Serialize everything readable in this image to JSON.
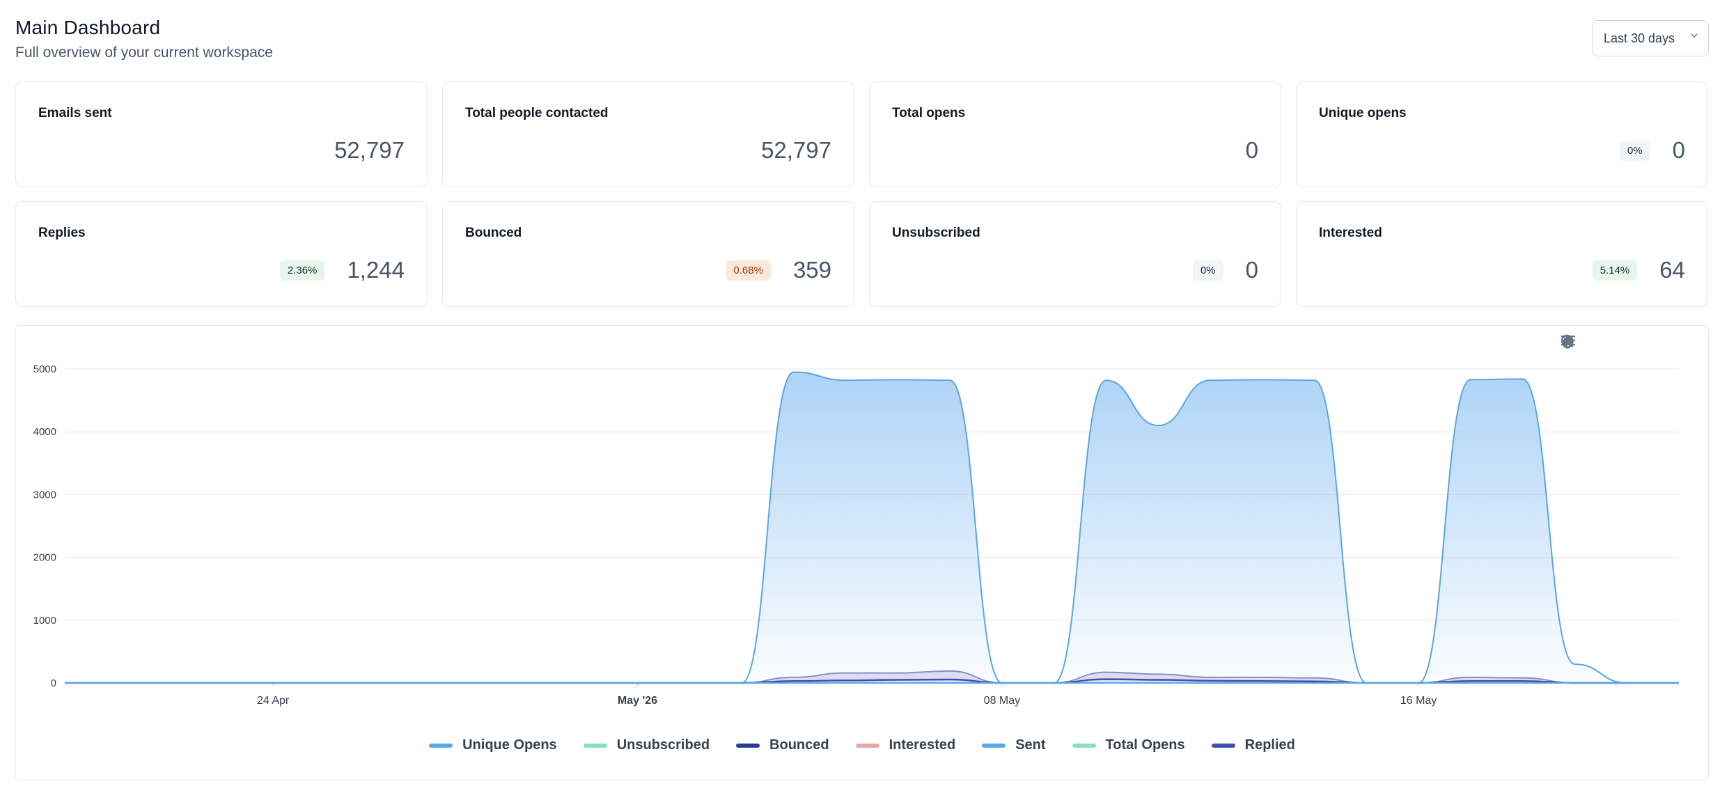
{
  "header": {
    "title": "Main Dashboard",
    "subtitle": "Full overview of your current workspace"
  },
  "range_select": {
    "value": "Last 30 days",
    "icon": "chevron-down-icon"
  },
  "cards": [
    {
      "label": "Emails sent",
      "value": "52,797",
      "badge": null,
      "badge_style": null
    },
    {
      "label": "Total people contacted",
      "value": "52,797",
      "badge": null,
      "badge_style": null
    },
    {
      "label": "Total opens",
      "value": "0",
      "badge": null,
      "badge_style": null
    },
    {
      "label": "Unique opens",
      "value": "0",
      "badge": "0%",
      "badge_style": "neutral"
    },
    {
      "label": "Replies",
      "value": "1,244",
      "badge": "2.36%",
      "badge_style": "green"
    },
    {
      "label": "Bounced",
      "value": "359",
      "badge": "0.68%",
      "badge_style": "orange"
    },
    {
      "label": "Unsubscribed",
      "value": "0",
      "badge": "0%",
      "badge_style": "neutral"
    },
    {
      "label": "Interested",
      "value": "64",
      "badge": "5.14%",
      "badge_style": "green"
    }
  ],
  "toolbar": [
    "zoom-in-icon",
    "zoom-out-icon",
    "zoom-select-icon",
    "pan-hand-icon",
    "home-icon",
    "menu-icon"
  ],
  "colors": {
    "sent": "#5aa6e6",
    "sent_fill": "#a9d1f6",
    "bounced": "#2b3a9a",
    "replied": "#3f4fb0",
    "green_series": "#88e1b9",
    "interested": "#e4a8a8",
    "grid": "#e5e7eb"
  },
  "chart_data": {
    "type": "area",
    "x_start": "2026-04-20",
    "x_end": "2026-05-21",
    "x_tick_labels": [
      {
        "date": "2026-04-24",
        "label": "24 Apr",
        "bold": false
      },
      {
        "date": "2026-05-01",
        "label": "May '26",
        "bold": true
      },
      {
        "date": "2026-05-08",
        "label": "08 May",
        "bold": false
      },
      {
        "date": "2026-05-16",
        "label": "16 May",
        "bold": false
      }
    ],
    "ylim": [
      0,
      5000
    ],
    "y_ticks": [
      "0",
      "1000",
      "2000",
      "3000",
      "4000",
      "5000"
    ],
    "grid": true,
    "legend_position": "bottom",
    "legend": [
      {
        "name": "Unique Opens",
        "color": "#5aa6e6"
      },
      {
        "name": "Unsubscribed",
        "color": "#88e1b9"
      },
      {
        "name": "Bounced",
        "color": "#2b3a9a"
      },
      {
        "name": "Interested",
        "color": "#e4a8a8"
      },
      {
        "name": "Sent",
        "color": "#5aa6e6"
      },
      {
        "name": "Total Opens",
        "color": "#88e1b9"
      },
      {
        "name": "Replied",
        "color": "#3f4fb0"
      }
    ],
    "series": [
      {
        "name": "Sent",
        "x": [
          "2026-04-20",
          "2026-05-03",
          "2026-05-04",
          "2026-05-05",
          "2026-05-06",
          "2026-05-07",
          "2026-05-08",
          "2026-05-09",
          "2026-05-10",
          "2026-05-11",
          "2026-05-12",
          "2026-05-13",
          "2026-05-14",
          "2026-05-15",
          "2026-05-16",
          "2026-05-17",
          "2026-05-18",
          "2026-05-19",
          "2026-05-20",
          "2026-05-21"
        ],
        "values": [
          0,
          0,
          4950,
          4820,
          4830,
          4820,
          0,
          0,
          4820,
          4100,
          4820,
          4830,
          4820,
          0,
          0,
          4830,
          4840,
          300,
          0,
          0
        ]
      },
      {
        "name": "Bounced",
        "x": [
          "2026-04-20",
          "2026-05-03",
          "2026-05-04",
          "2026-05-05",
          "2026-05-06",
          "2026-05-07",
          "2026-05-08",
          "2026-05-09",
          "2026-05-10",
          "2026-05-11",
          "2026-05-12",
          "2026-05-13",
          "2026-05-14",
          "2026-05-15",
          "2026-05-16",
          "2026-05-17",
          "2026-05-18",
          "2026-05-19",
          "2026-05-20",
          "2026-05-21"
        ],
        "values": [
          0,
          0,
          90,
          160,
          160,
          190,
          0,
          0,
          170,
          140,
          90,
          90,
          80,
          0,
          0,
          90,
          80,
          0,
          0,
          0
        ]
      },
      {
        "name": "Replied",
        "x": [
          "2026-04-20",
          "2026-05-03",
          "2026-05-04",
          "2026-05-05",
          "2026-05-06",
          "2026-05-07",
          "2026-05-08",
          "2026-05-09",
          "2026-05-10",
          "2026-05-11",
          "2026-05-12",
          "2026-05-13",
          "2026-05-14",
          "2026-05-15",
          "2026-05-16",
          "2026-05-17",
          "2026-05-18",
          "2026-05-19",
          "2026-05-20",
          "2026-05-21"
        ],
        "values": [
          0,
          0,
          30,
          40,
          50,
          55,
          0,
          0,
          60,
          50,
          35,
          30,
          25,
          0,
          0,
          30,
          30,
          0,
          0,
          0
        ]
      }
    ]
  }
}
